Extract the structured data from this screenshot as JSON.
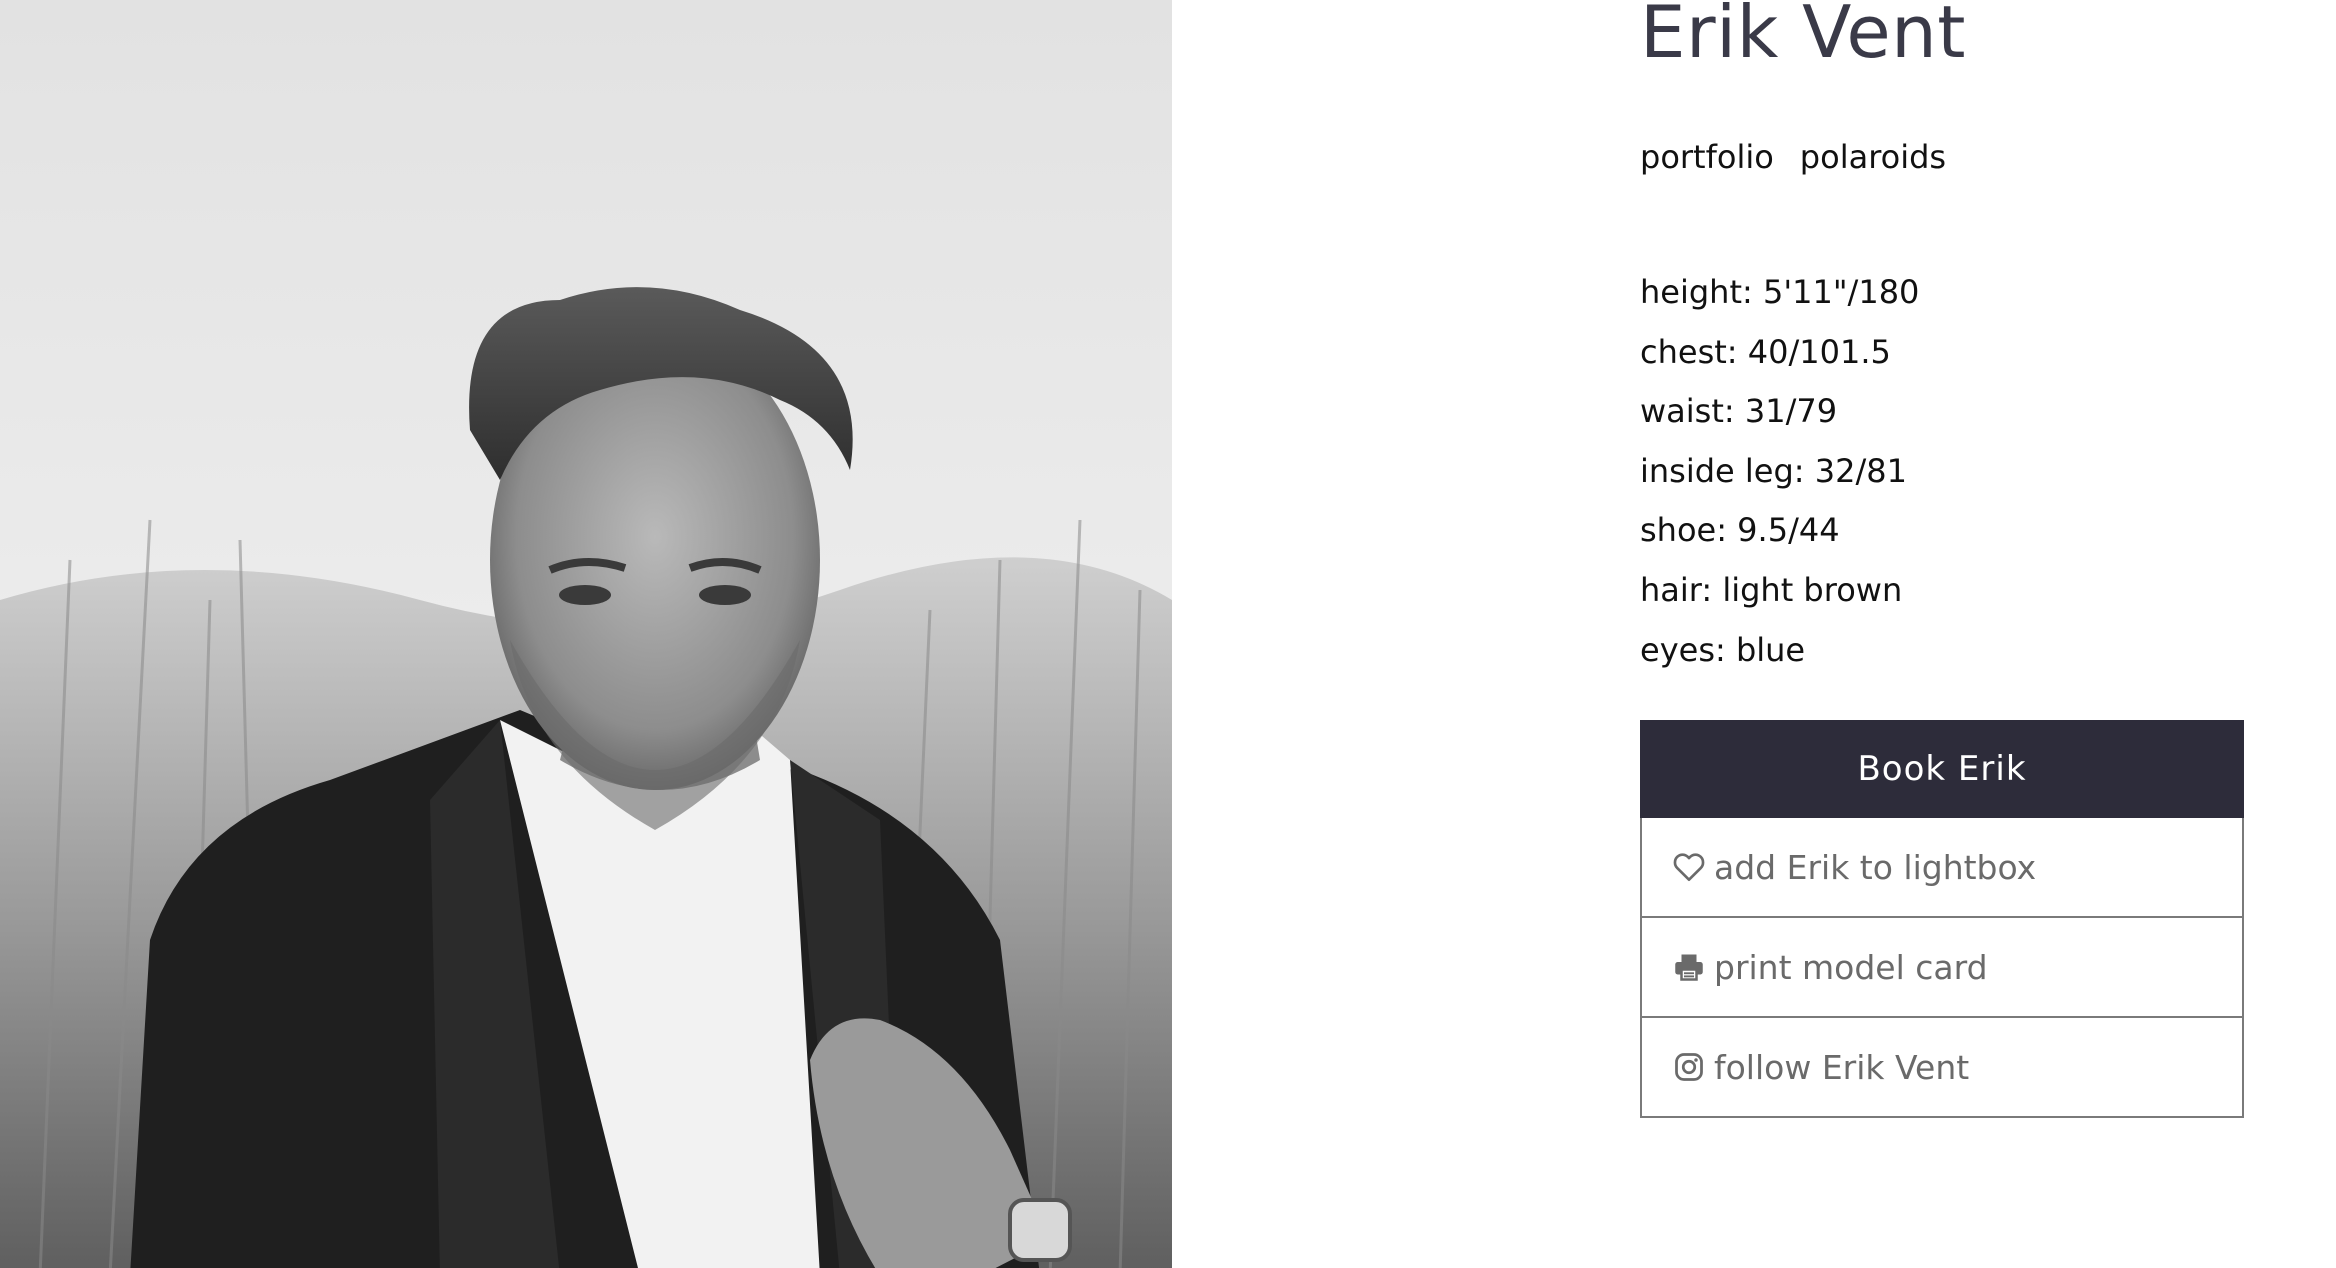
{
  "model": {
    "name": "Erik Vent",
    "photo_alt": "Black and white portrait of Erik Vent"
  },
  "tabs": [
    {
      "label": "portfolio"
    },
    {
      "label": "polaroids"
    }
  ],
  "stats": [
    {
      "text": "height: 5'11\"/180"
    },
    {
      "text": "chest: 40/101.5"
    },
    {
      "text": "waist: 31/79"
    },
    {
      "text": "inside leg: 32/81"
    },
    {
      "text": "shoe: 9.5/44"
    },
    {
      "text": "hair: light brown"
    },
    {
      "text": "eyes: blue"
    }
  ],
  "actions": {
    "book_label": "Book Erik",
    "lightbox_label": "add Erik to lightbox",
    "lightbox_icon": "heart-icon",
    "print_label": "print model card",
    "print_icon": "printer-icon",
    "follow_label": "follow Erik Vent",
    "follow_icon": "instagram-icon"
  },
  "colors": {
    "name": "#3a3a48",
    "book_button_bg": "#2d2c3a",
    "action_text": "#6a6a6a",
    "action_border": "#7a7a7a"
  }
}
